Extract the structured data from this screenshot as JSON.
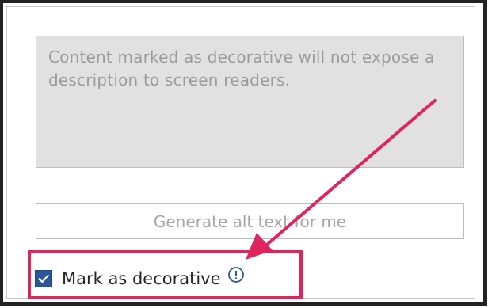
{
  "alt_text": {
    "description_placeholder": "Content marked as decorative will not expose a description to screen readers.",
    "generate_button_label": "Generate alt text for me",
    "decorative_checkbox": {
      "label": "Mark as decorative",
      "checked": true
    }
  },
  "icons": {
    "checkbox": "checkmark-icon",
    "info": "info-icon"
  },
  "colors": {
    "checkbox_fill": "#2b579a",
    "annotation": "#e0245e",
    "disabled_text": "#9b9b9b"
  }
}
